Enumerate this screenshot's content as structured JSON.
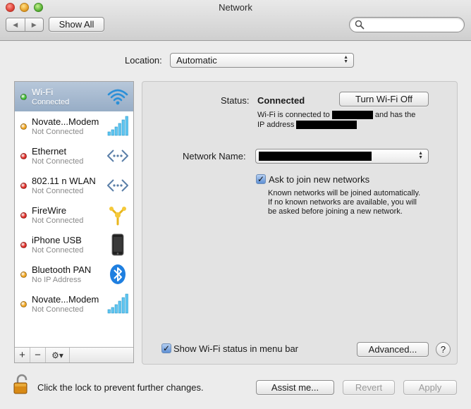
{
  "window": {
    "title": "Network"
  },
  "toolbar": {
    "back_glyph": "◀",
    "forward_glyph": "▶",
    "show_all_label": "Show All",
    "search_icon": "search-icon"
  },
  "location": {
    "label": "Location:",
    "value": "Automatic"
  },
  "services": [
    {
      "name": "Wi-Fi",
      "status": "Connected",
      "indicator": "#3fbf34",
      "icon": "wifi-icon",
      "selected": true
    },
    {
      "name": "Novate...Modem",
      "status": "Not Connected",
      "indicator": "#f2a51c",
      "icon": "signal-bars-icon",
      "selected": false
    },
    {
      "name": "Ethernet",
      "status": "Not Connected",
      "indicator": "#e02a24",
      "icon": "ethernet-icon",
      "selected": false
    },
    {
      "name": "802.11 n WLAN",
      "status": "Not Connected",
      "indicator": "#e02a24",
      "icon": "ethernet-icon",
      "selected": false
    },
    {
      "name": "FireWire",
      "status": "Not Connected",
      "indicator": "#e02a24",
      "icon": "firewire-icon",
      "selected": false
    },
    {
      "name": "iPhone USB",
      "status": "Not Connected",
      "indicator": "#e02a24",
      "icon": "iphone-icon",
      "selected": false
    },
    {
      "name": "Bluetooth PAN",
      "status": "No IP Address",
      "indicator": "#f2a51c",
      "icon": "bluetooth-icon",
      "selected": false
    },
    {
      "name": "Novate...Modem",
      "status": "Not Connected",
      "indicator": "#f2a51c",
      "icon": "signal-bars-icon",
      "selected": false
    }
  ],
  "sidebar_actions": {
    "add": "+",
    "remove": "−",
    "gear": "⚙▾"
  },
  "detail": {
    "status_label": "Status:",
    "status_value": "Connected",
    "turn_off_label": "Turn Wi-Fi Off",
    "connected_text_1": "Wi-Fi is connected to",
    "connected_text_2": "and has the",
    "connected_text_3": "IP address",
    "network_name_label": "Network Name:",
    "ask_join_label": "Ask to join new networks",
    "ask_join_checked": true,
    "ask_join_desc_1": "Known networks will be joined automatically.",
    "ask_join_desc_2": "If no known networks are available, you will",
    "ask_join_desc_3": "be asked before joining a new network.",
    "show_status_label": "Show Wi-Fi status in menu bar",
    "show_status_checked": true,
    "advanced_label": "Advanced...",
    "help_label": "?"
  },
  "footer": {
    "lock_text": "Click the lock to prevent further changes.",
    "assist_label": "Assist me...",
    "revert_label": "Revert",
    "apply_label": "Apply"
  },
  "colors": {
    "selection": "#a6b9cf",
    "checkbox": "#5d8fd4",
    "pane": "#e3e3e3",
    "lock": "#d88a16"
  }
}
